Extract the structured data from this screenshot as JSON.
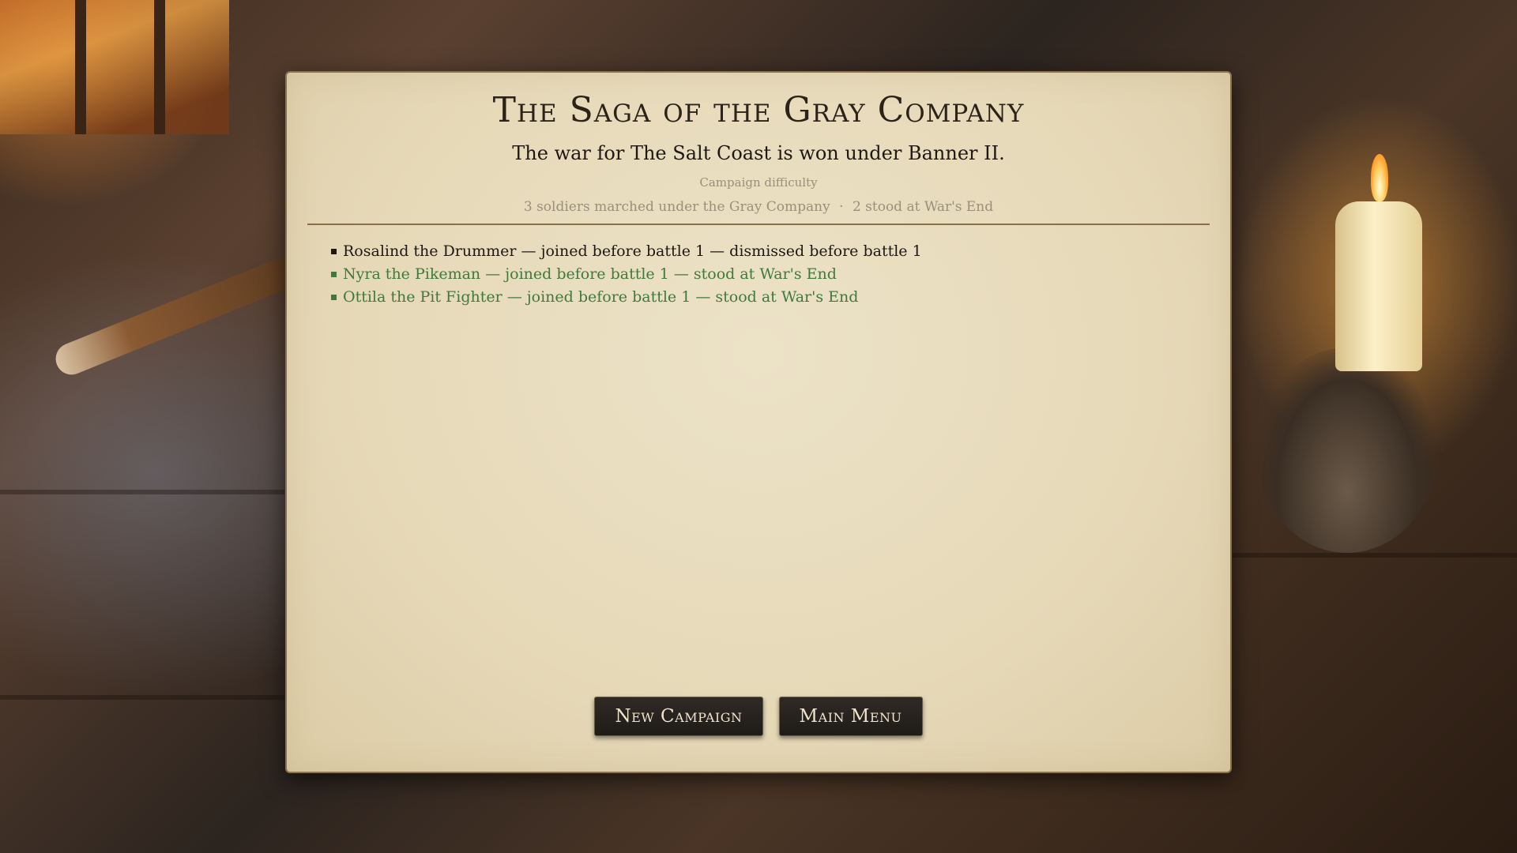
{
  "summary": {
    "title": "The Saga of the Gray Company",
    "subtitle": "The war for The Salt Coast is won under Banner II.",
    "difficulty_label": "Campaign difficulty",
    "stats_marched": "3 soldiers marched under the Gray Company",
    "stats_separator": "·",
    "stats_stood": "2 stood at War's End"
  },
  "roster": [
    {
      "text": "Rosalind the Drummer — joined before battle 1 — dismissed before battle 1",
      "status": "dismissed",
      "color": "#1e1812"
    },
    {
      "text": "Nyra the Pikeman — joined before battle 1 — stood at War's End",
      "status": "survived",
      "color": "#3f7a3a"
    },
    {
      "text": "Ottila the Pit Fighter — joined before battle 1 — stood at War's End",
      "status": "survived",
      "color": "#3f7a3a"
    }
  ],
  "actions": {
    "new_campaign": "New Campaign",
    "main_menu": "Main Menu"
  },
  "colors": {
    "survived": "#3f7a3a",
    "dismissed": "#1e1812",
    "panel": "#e6d9b8",
    "button": "#24201c"
  }
}
